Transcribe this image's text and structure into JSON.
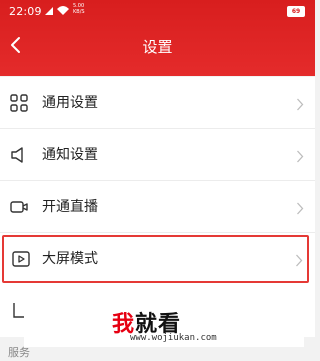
{
  "status_bar": {
    "time": "22:09",
    "network_speed_value": "5.00",
    "network_speed_unit": "KB/S",
    "battery": "69"
  },
  "nav": {
    "title": "设置"
  },
  "menu": {
    "items": [
      {
        "label": "通用设置",
        "icon": "grid-icon"
      },
      {
        "label": "通知设置",
        "icon": "speaker-icon"
      },
      {
        "label": "开通直播",
        "icon": "camera-icon"
      },
      {
        "label": "大屏模式",
        "icon": "play-icon",
        "highlighted": true
      }
    ]
  },
  "section": {
    "label": "服务"
  },
  "watermark": {
    "brand_part1": "我",
    "brand_part2": "就看",
    "url": "www.wojiukan.com"
  },
  "colors": {
    "header_red": "#d81e1e",
    "highlight_border": "#e53935",
    "watermark_red": "#e60012"
  }
}
